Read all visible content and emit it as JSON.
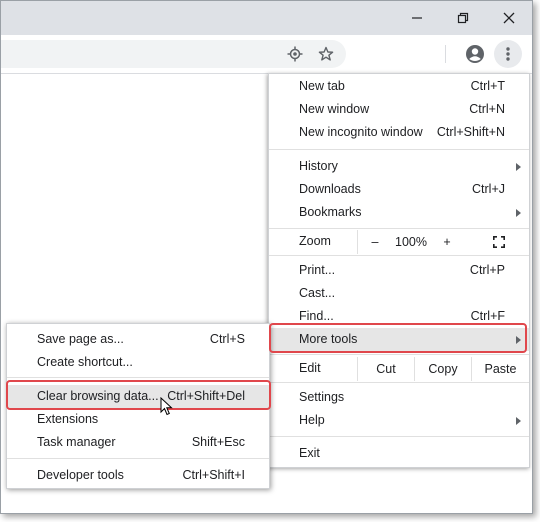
{
  "window": {
    "minimize_icon": "minimize-icon",
    "restore_icon": "restore-icon",
    "close_icon": "close-icon"
  },
  "toolbar": {
    "icons": [
      "location-icon",
      "bookmark-star-icon",
      "profile-icon",
      "more-vert-icon"
    ]
  },
  "menu": {
    "new_tab": {
      "label": "New tab",
      "shortcut": "Ctrl+T"
    },
    "new_window": {
      "label": "New window",
      "shortcut": "Ctrl+N"
    },
    "new_incognito": {
      "label": "New incognito window",
      "shortcut": "Ctrl+Shift+N"
    },
    "history": {
      "label": "History"
    },
    "downloads": {
      "label": "Downloads",
      "shortcut": "Ctrl+J"
    },
    "bookmarks": {
      "label": "Bookmarks"
    },
    "zoom": {
      "label": "Zoom",
      "minus": "–",
      "value": "100%",
      "plus": "+"
    },
    "print": {
      "label": "Print...",
      "shortcut": "Ctrl+P"
    },
    "cast": {
      "label": "Cast..."
    },
    "find": {
      "label": "Find...",
      "shortcut": "Ctrl+F"
    },
    "more_tools": {
      "label": "More tools"
    },
    "edit": {
      "label": "Edit",
      "cut": "Cut",
      "copy": "Copy",
      "paste": "Paste"
    },
    "settings": {
      "label": "Settings"
    },
    "help": {
      "label": "Help"
    },
    "exit": {
      "label": "Exit"
    }
  },
  "submenu": {
    "save_page": {
      "label": "Save page as...",
      "shortcut": "Ctrl+S"
    },
    "create_shortcut": {
      "label": "Create shortcut..."
    },
    "clear_browsing": {
      "label": "Clear browsing data...",
      "shortcut": "Ctrl+Shift+Del"
    },
    "extensions": {
      "label": "Extensions"
    },
    "task_manager": {
      "label": "Task manager",
      "shortcut": "Shift+Esc"
    },
    "developer_tools": {
      "label": "Developer tools",
      "shortcut": "Ctrl+Shift+I"
    }
  },
  "colors": {
    "highlight_border": "#e0474c",
    "hover_bg": "#e6e6e6",
    "titlebar": "#dee1e6"
  }
}
